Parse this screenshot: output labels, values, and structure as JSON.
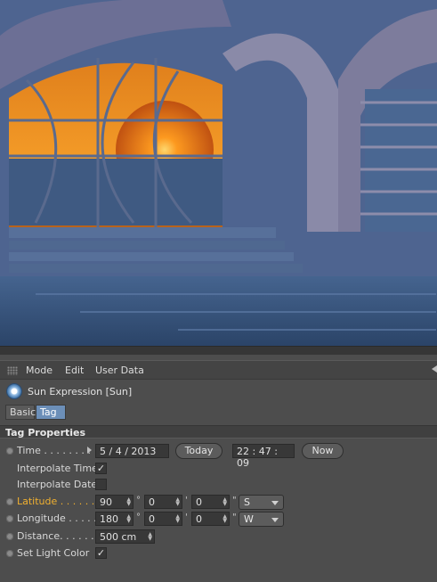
{
  "menu": {
    "mode": "Mode",
    "edit": "Edit",
    "user_data": "User Data"
  },
  "object": {
    "title": "Sun Expression [Sun]"
  },
  "tabs": {
    "basic": "Basic",
    "tag": "Tag"
  },
  "section": {
    "title": "Tag Properties"
  },
  "time": {
    "label": "Time . . . . . . . .",
    "date": "5 / 4 / 2013",
    "today": "Today",
    "clock": "22 : 47 : 09",
    "now": "Now"
  },
  "interpolate_time": {
    "label": "Interpolate Time",
    "checked": "✓"
  },
  "interpolate_date": {
    "label": "Interpolate Date",
    "checked": ""
  },
  "latitude": {
    "label": "Latitude . . . . . . .",
    "deg": "90",
    "min": "0",
    "sec": "0",
    "dir": "S"
  },
  "longitude": {
    "label": "Longitude . . . . .",
    "deg": "180",
    "min": "0",
    "sec": "0",
    "dir": "W"
  },
  "distance": {
    "label": "Distance. . . . . . .",
    "value": "500 cm"
  },
  "light_color": {
    "label": "Set Light Color",
    "checked": "✓"
  },
  "units": {
    "deg": "°",
    "min": "'",
    "sec": "\""
  },
  "colors": {
    "accent": "#f0b030",
    "tab_active": "#6c8fb8",
    "panel": "#4d4d4d"
  }
}
